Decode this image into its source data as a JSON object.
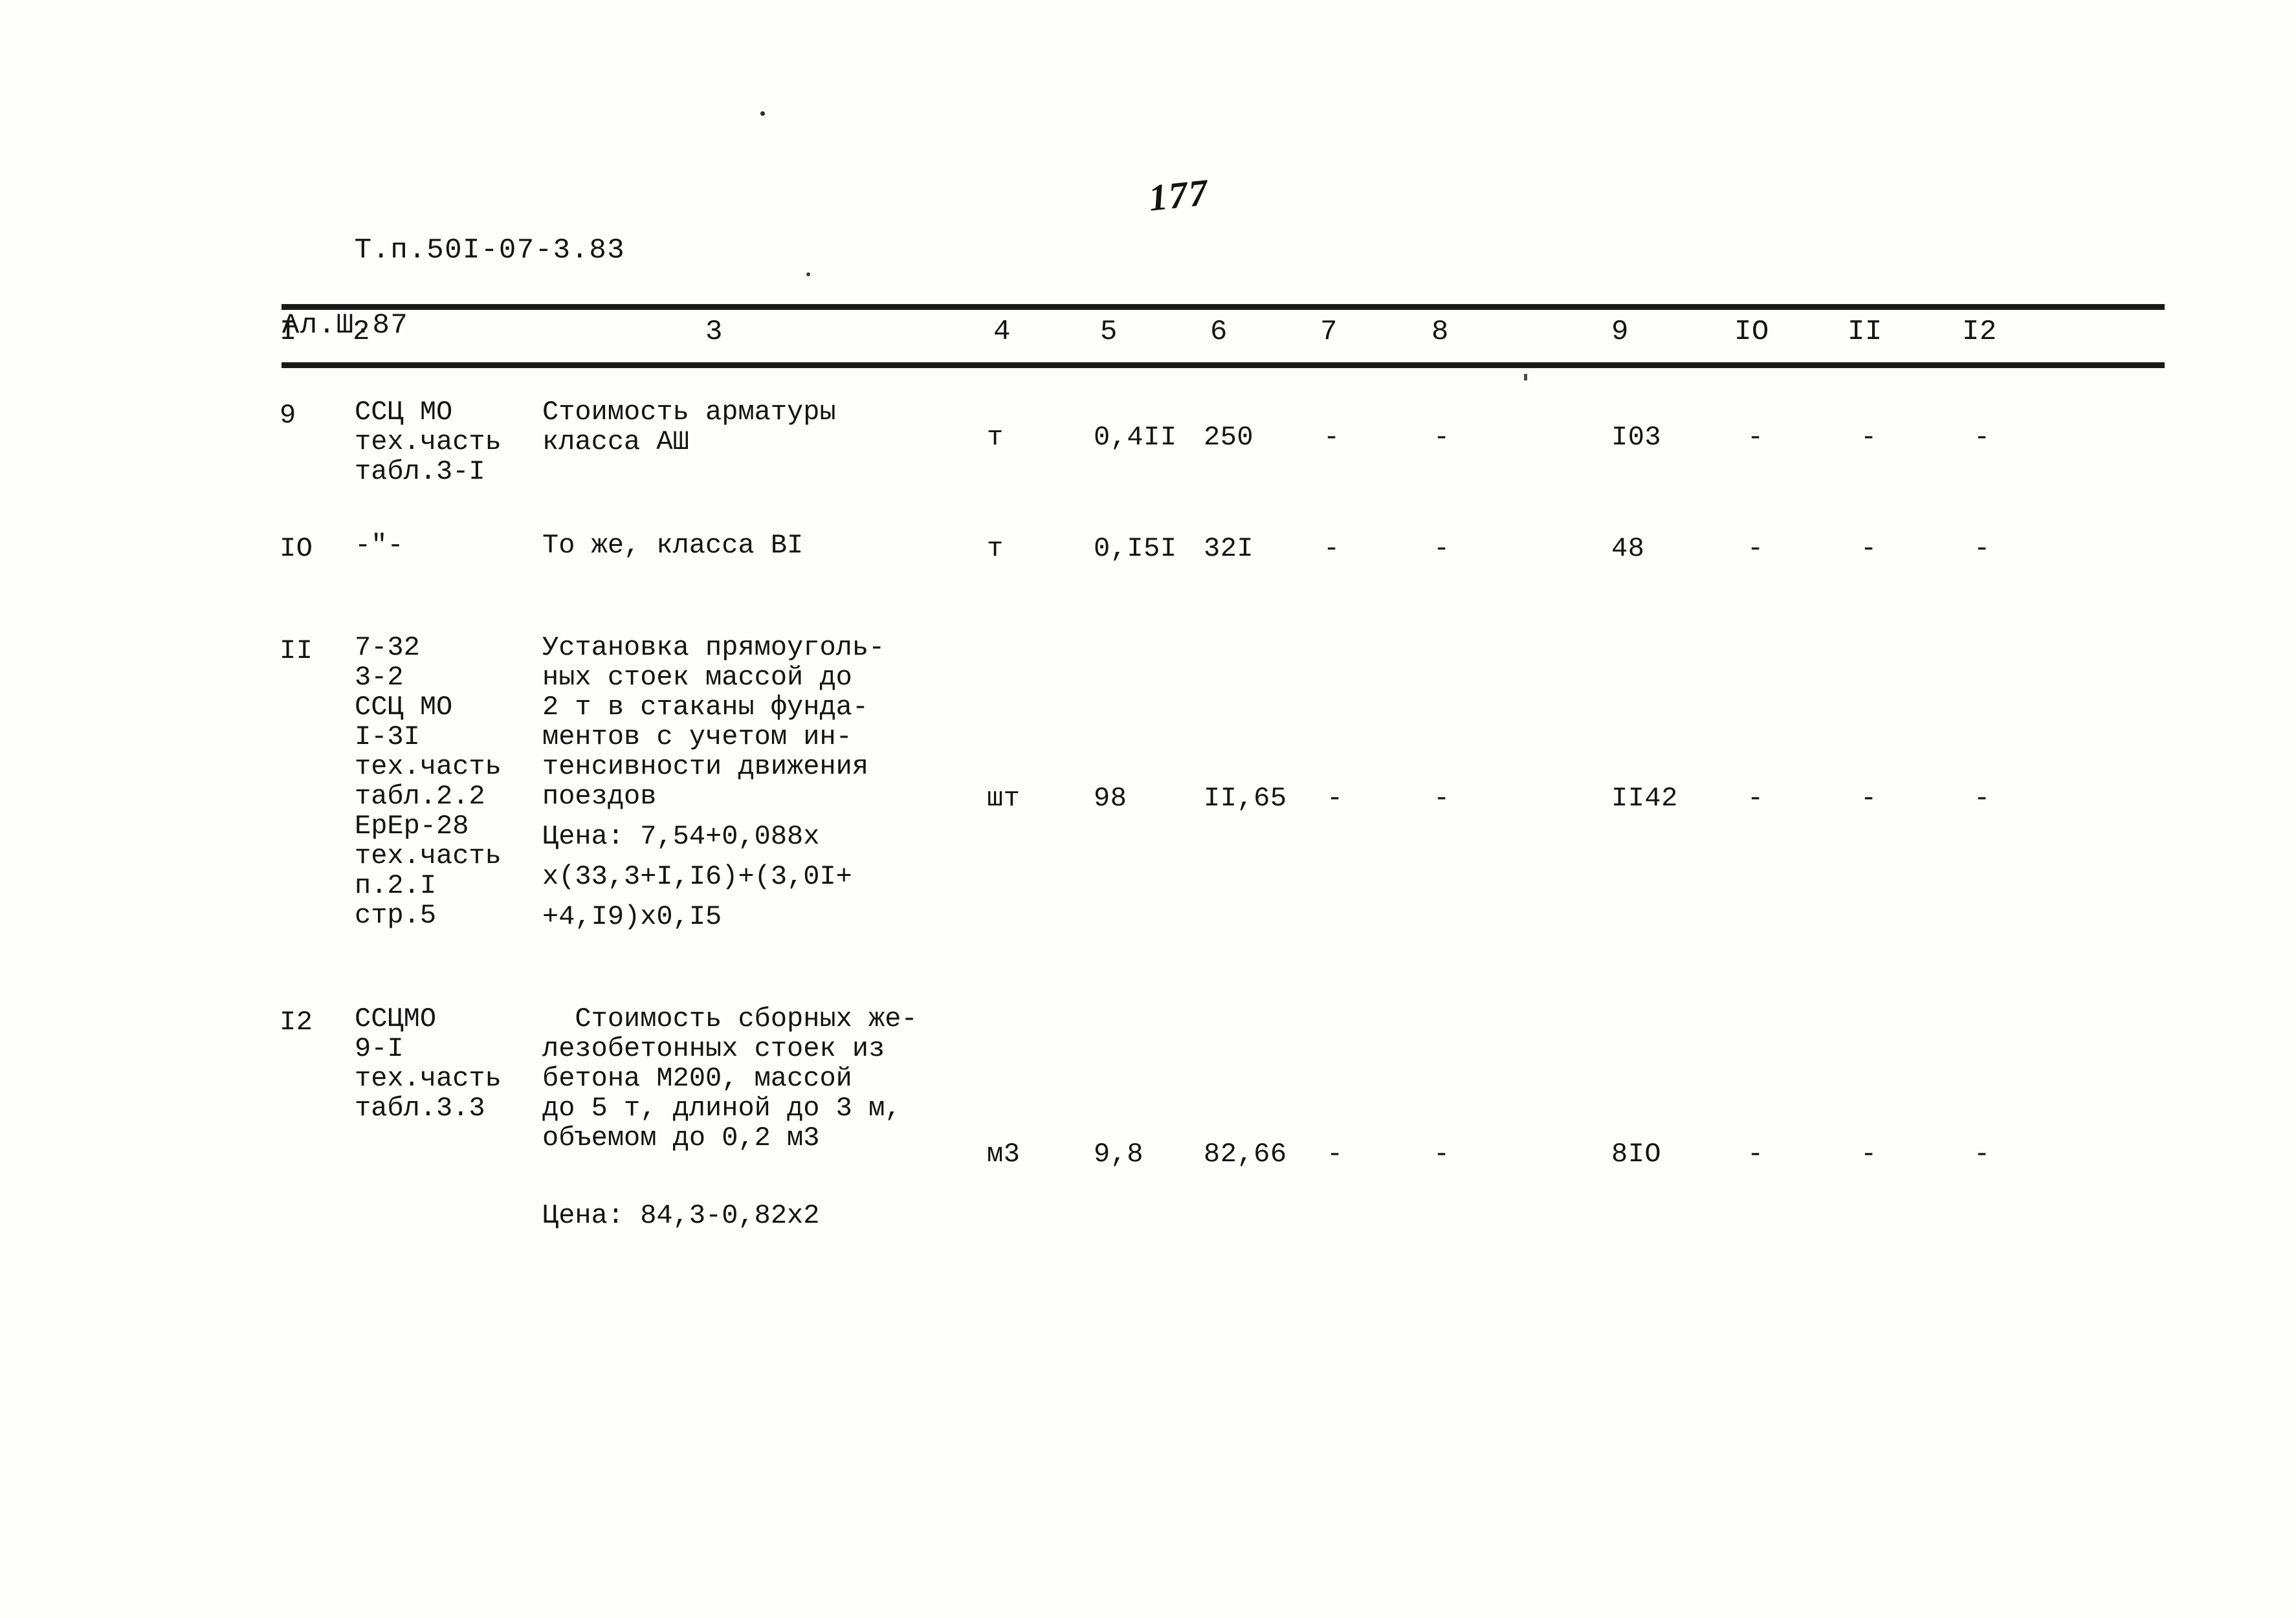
{
  "document": {
    "code_line1": "Т.п.50I-07-3.83",
    "code_line2": "Ал.Ш.87",
    "page_number": "177"
  },
  "table": {
    "headers": [
      "I",
      "2",
      "3",
      "4",
      "5",
      "6",
      "7",
      "8",
      "9",
      "IO",
      "II",
      "I2"
    ],
    "rows": [
      {
        "no": "9",
        "code_lines": [
          "ССЦ МО",
          "тех.часть",
          "табл.3-I"
        ],
        "desc_lines": [
          "Стоимость арматуры",
          "класса АШ"
        ],
        "unit": "т",
        "c5": "0,4II",
        "c6": "250",
        "c7": "-",
        "c8": "-",
        "c9": "I03",
        "c10": "-",
        "c11": "-",
        "c12": "-"
      },
      {
        "no": "IO",
        "code_lines": [
          "-\"-"
        ],
        "desc_lines": [
          "То же, класса ВI"
        ],
        "unit": "т",
        "c5": "0,I5I",
        "c6": "32I",
        "c7": "-",
        "c8": "-",
        "c9": "48",
        "c10": "-",
        "c11": "-",
        "c12": "-"
      },
      {
        "no": "II",
        "code_lines": [
          "7-32",
          "3-2",
          "ССЦ МО",
          "I-3I",
          "тех.часть",
          "табл.2.2",
          "ЕрЕр-28",
          "тех.часть",
          "п.2.I",
          "стр.5"
        ],
        "desc_lines": [
          "Установка прямоуголь-",
          "ных стоек массой до",
          "2 т в стаканы фунда-",
          "ментов с учетом ин-",
          "тенсивности движения",
          "поездов"
        ],
        "formula_lines": [
          "Цена: 7,54+0,088х",
          "х(33,3+I,I6)+(3,0I+",
          "+4,I9)х0,I5"
        ],
        "unit": "шт",
        "c5": "98",
        "c6": "II,65",
        "c7": "-",
        "c8": "-",
        "c9": "II42",
        "c10": "-",
        "c11": "-",
        "c12": "-"
      },
      {
        "no": "I2",
        "code_lines": [
          "ССЦМО",
          "9-I",
          "тех.часть",
          "табл.3.3"
        ],
        "desc_lines": [
          "  Стоимость сборных же-",
          "лезобетонных стоек из",
          "бетона М200, массой",
          "до 5 т, длиной до 3 м,",
          "объемом до 0,2 м3"
        ],
        "formula_lines": [
          "Цена: 84,3-0,82х2"
        ],
        "unit": "м3",
        "c5": "9,8",
        "c6": "82,66",
        "c7": "-",
        "c8": "-",
        "c9": "8IO",
        "c10": "-",
        "c11": "-",
        "c12": "-"
      }
    ]
  }
}
